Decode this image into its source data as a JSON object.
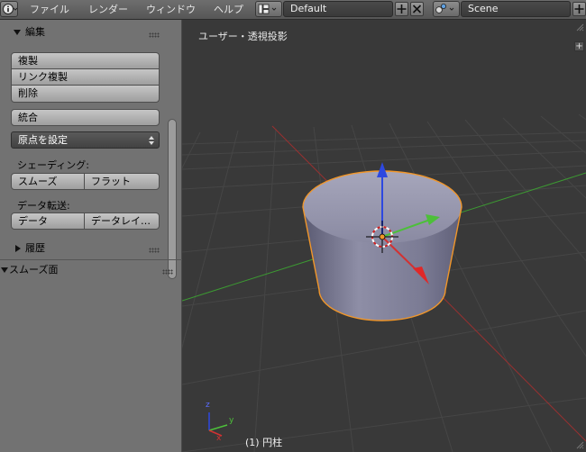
{
  "header": {
    "menus": [
      "ファイル",
      "レンダー",
      "ウィンドウ",
      "ヘルプ"
    ],
    "screen_layout": "Default",
    "scene": "Scene"
  },
  "tool_shelf": {
    "edit_panel": {
      "title": "編集",
      "duplicate": "複製",
      "duplicate_linked": "リンク複製",
      "delete": "削除",
      "join": "統合",
      "set_origin": "原点を設定",
      "shading_label": "シェーディング:",
      "smooth": "スムーズ",
      "flat": "フラット",
      "data_transfer_label": "データ転送:",
      "data": "データ",
      "data_layout": "データレイ…"
    },
    "history_panel": {
      "title": "履歴"
    },
    "operator_panel": {
      "title": "スムーズ面"
    }
  },
  "viewport": {
    "view_label": "ユーザー・透視投影",
    "object_label": "(1) 円柱",
    "mini_axis": {
      "x": "x",
      "y": "y",
      "z": "z"
    }
  },
  "colors": {
    "x_axis": "#c83c3c",
    "y_axis": "#4dbf3a",
    "z_axis": "#2d48e0",
    "selection_outline": "#f0962a"
  }
}
